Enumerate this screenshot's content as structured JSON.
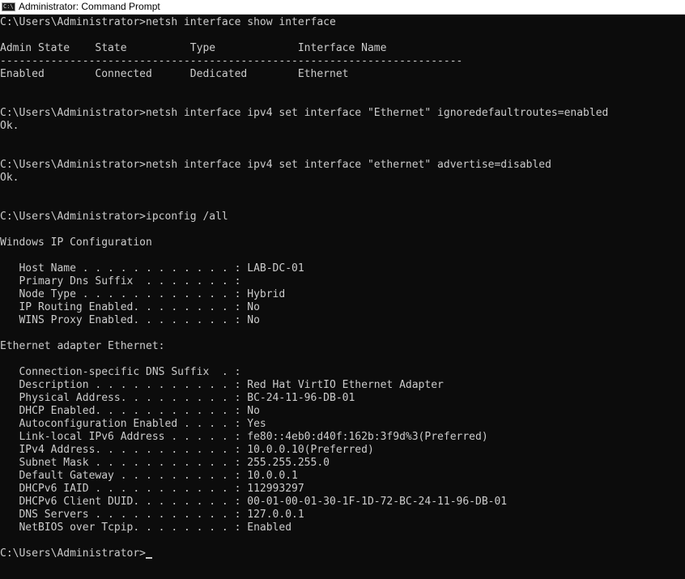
{
  "window": {
    "title": "Administrator: Command Prompt",
    "icon": "cmd-icon",
    "icon_glyph": "C:\\"
  },
  "console": {
    "lines": [
      "C:\\Users\\Administrator>netsh interface show interface",
      "",
      "Admin State    State          Type             Interface Name",
      "-------------------------------------------------------------------------",
      "Enabled        Connected      Dedicated        Ethernet",
      "",
      "",
      "C:\\Users\\Administrator>netsh interface ipv4 set interface \"Ethernet\" ignoredefaultroutes=enabled",
      "Ok.",
      "",
      "",
      "C:\\Users\\Administrator>netsh interface ipv4 set interface \"ethernet\" advertise=disabled",
      "Ok.",
      "",
      "",
      "C:\\Users\\Administrator>ipconfig /all",
      "",
      "Windows IP Configuration",
      "",
      "   Host Name . . . . . . . . . . . . : LAB-DC-01",
      "   Primary Dns Suffix  . . . . . . . :",
      "   Node Type . . . . . . . . . . . . : Hybrid",
      "   IP Routing Enabled. . . . . . . . : No",
      "   WINS Proxy Enabled. . . . . . . . : No",
      "",
      "Ethernet adapter Ethernet:",
      "",
      "   Connection-specific DNS Suffix  . :",
      "   Description . . . . . . . . . . . : Red Hat VirtIO Ethernet Adapter",
      "   Physical Address. . . . . . . . . : BC-24-11-96-DB-01",
      "   DHCP Enabled. . . . . . . . . . . : No",
      "   Autoconfiguration Enabled . . . . : Yes",
      "   Link-local IPv6 Address . . . . . : fe80::4eb0:d40f:162b:3f9d%3(Preferred)",
      "   IPv4 Address. . . . . . . . . . . : 10.0.0.10(Preferred)",
      "   Subnet Mask . . . . . . . . . . . : 255.255.255.0",
      "   Default Gateway . . . . . . . . . : 10.0.0.1",
      "   DHCPv6 IAID . . . . . . . . . . . : 112993297",
      "   DHCPv6 Client DUID. . . . . . . . : 00-01-00-01-30-1F-1D-72-BC-24-11-96-DB-01",
      "   DNS Servers . . . . . . . . . . . : 127.0.0.1",
      "   NetBIOS over Tcpip. . . . . . . . : Enabled",
      "",
      "C:\\Users\\Administrator>"
    ]
  },
  "colors": {
    "background": "#0c0c0c",
    "text": "#cccccc",
    "titlebar": "#ffffff"
  }
}
